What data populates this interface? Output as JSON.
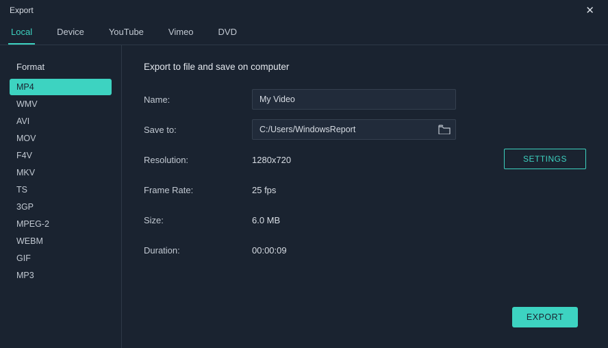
{
  "window": {
    "title": "Export"
  },
  "tabs": [
    {
      "label": "Local"
    },
    {
      "label": "Device"
    },
    {
      "label": "YouTube"
    },
    {
      "label": "Vimeo"
    },
    {
      "label": "DVD"
    }
  ],
  "sidebar": {
    "heading": "Format",
    "items": [
      {
        "label": "MP4"
      },
      {
        "label": "WMV"
      },
      {
        "label": "AVI"
      },
      {
        "label": "MOV"
      },
      {
        "label": "F4V"
      },
      {
        "label": "MKV"
      },
      {
        "label": "TS"
      },
      {
        "label": "3GP"
      },
      {
        "label": "MPEG-2"
      },
      {
        "label": "WEBM"
      },
      {
        "label": "GIF"
      },
      {
        "label": "MP3"
      }
    ]
  },
  "main": {
    "heading": "Export to file and save on computer",
    "labels": {
      "name": "Name:",
      "saveTo": "Save to:",
      "resolution": "Resolution:",
      "frameRate": "Frame Rate:",
      "size": "Size:",
      "duration": "Duration:"
    },
    "values": {
      "name": "My Video",
      "saveTo": "C:/Users/WindowsReport",
      "resolution": "1280x720",
      "frameRate": "25 fps",
      "size": "6.0 MB",
      "duration": "00:00:09"
    },
    "buttons": {
      "settings": "SETTINGS",
      "export": "EXPORT"
    }
  },
  "colors": {
    "accent": "#3dd3c1",
    "bg": "#1a2330",
    "panel": "#212b3a"
  }
}
